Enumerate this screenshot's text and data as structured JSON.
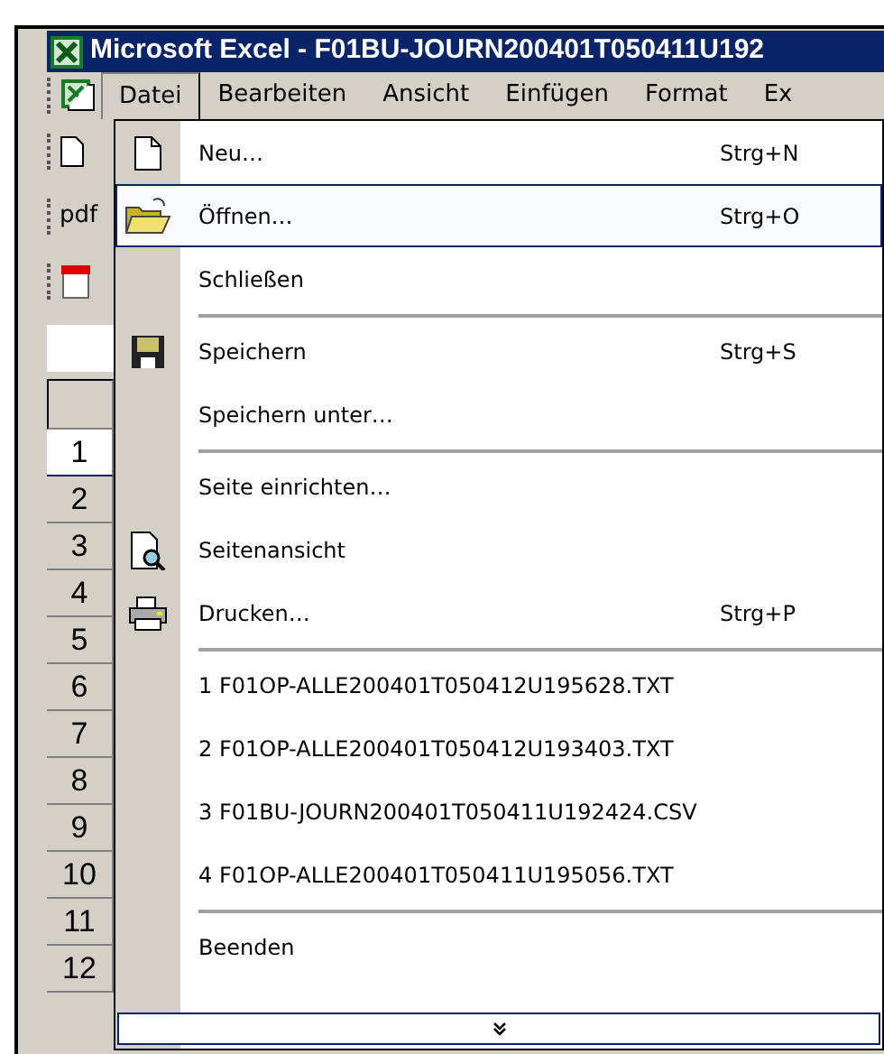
{
  "window": {
    "title": "Microsoft Excel - F01BU-JOURN200401T050411U192"
  },
  "menu_bar": [
    {
      "label": "Datei",
      "selected": true
    },
    {
      "label": "Bearbeiten",
      "selected": false
    },
    {
      "label": "Ansicht",
      "selected": false
    },
    {
      "label": "Einfügen",
      "selected": false
    },
    {
      "label": "Format",
      "selected": false
    },
    {
      "label": "Ex",
      "selected": false
    }
  ],
  "toolbar": {
    "label": "pdf"
  },
  "row_headers": [
    {
      "label": "1",
      "selected": true
    },
    {
      "label": "2",
      "selected": false
    },
    {
      "label": "3",
      "selected": false
    },
    {
      "label": "4",
      "selected": false
    },
    {
      "label": "5",
      "selected": false
    },
    {
      "label": "6",
      "selected": false
    },
    {
      "label": "7",
      "selected": false
    },
    {
      "label": "8",
      "selected": false
    },
    {
      "label": "9",
      "selected": false
    },
    {
      "label": "10",
      "selected": false
    },
    {
      "label": "11",
      "selected": false
    },
    {
      "label": "12",
      "selected": false
    }
  ],
  "file_menu": {
    "items": [
      {
        "kind": "item",
        "label": "Neu…",
        "shortcut": "Strg+N",
        "selected": false
      },
      {
        "kind": "item",
        "label": "Öffnen…",
        "shortcut": "Strg+O",
        "selected": true
      },
      {
        "kind": "item",
        "label": "Schließen",
        "selected": false
      },
      {
        "kind": "separator"
      },
      {
        "kind": "item",
        "label": "Speichern",
        "shortcut": "Strg+S",
        "selected": false
      },
      {
        "kind": "item",
        "label": "Speichern unter…",
        "selected": false
      },
      {
        "kind": "separator"
      },
      {
        "kind": "item",
        "label": "Seite einrichten…",
        "selected": false
      },
      {
        "kind": "item",
        "label": "Seitenansicht",
        "selected": false
      },
      {
        "kind": "item",
        "label": "Drucken…",
        "shortcut": "Strg+P",
        "selected": false
      },
      {
        "kind": "separator"
      },
      {
        "kind": "item",
        "label": "1 F01OP-ALLE200401T050412U195628.TXT",
        "selected": false
      },
      {
        "kind": "item",
        "label": "2 F01OP-ALLE200401T050412U193403.TXT",
        "selected": false
      },
      {
        "kind": "item",
        "label": "3 F01BU-JOURN200401T050411U192424.CSV",
        "selected": false
      },
      {
        "kind": "item",
        "label": "4 F01OP-ALLE200401T050411U195056.TXT",
        "selected": false
      },
      {
        "kind": "separator"
      },
      {
        "kind": "item",
        "label": "Beenden",
        "selected": false
      }
    ]
  }
}
